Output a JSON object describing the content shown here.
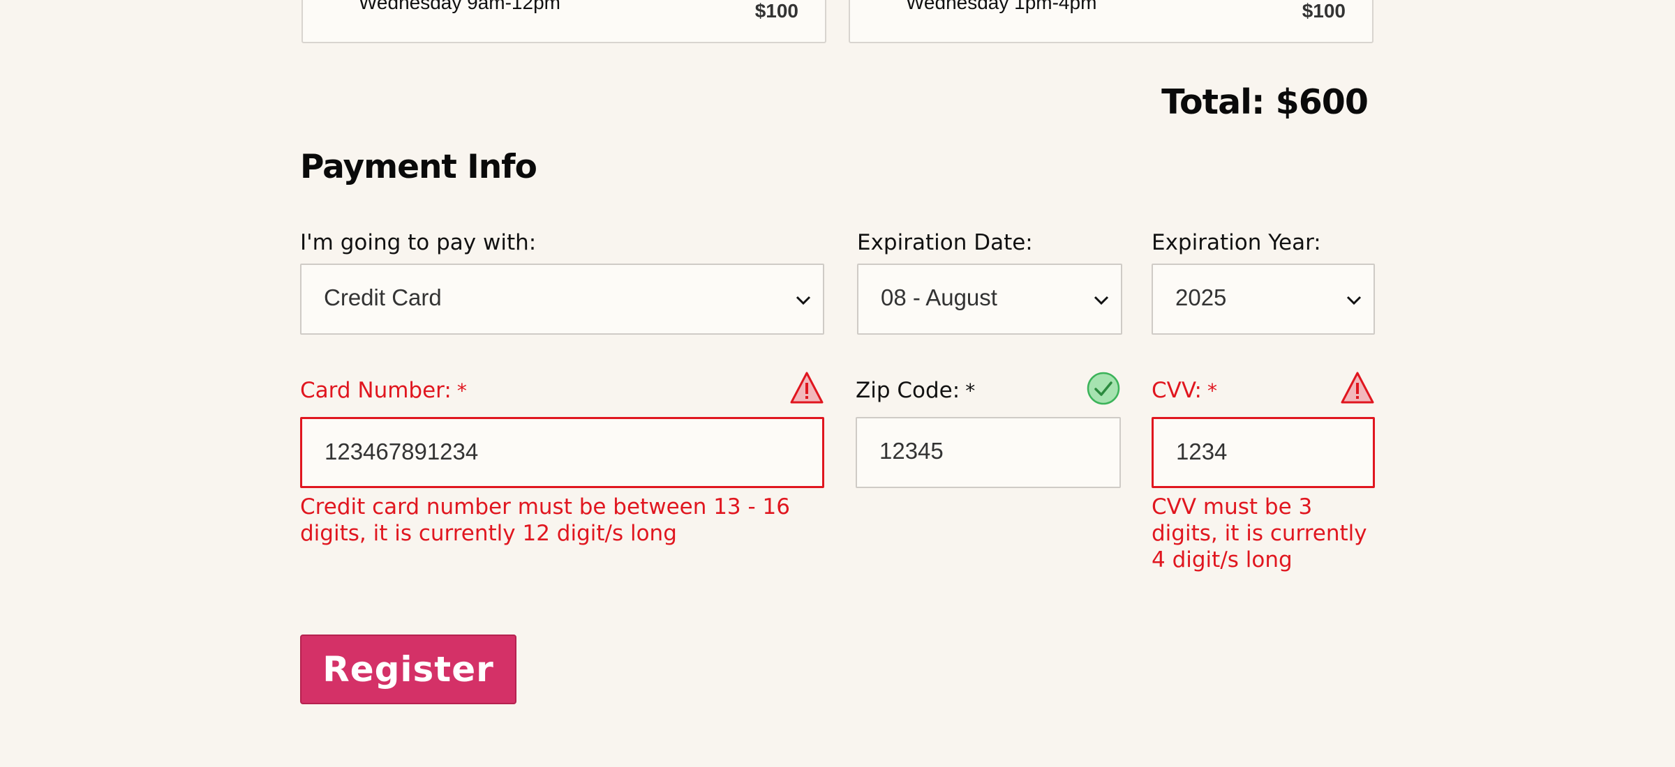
{
  "workshops": [
    {
      "time": "Wednesday 9am-12pm",
      "price": "$100"
    },
    {
      "time": "Wednesday 1pm-4pm",
      "price": "$100"
    }
  ],
  "total": "Total: $600",
  "payment": {
    "title": "Payment Info",
    "method": {
      "label": "I'm going to pay with:",
      "value": "Credit Card"
    },
    "exp_date": {
      "label": "Expiration Date:",
      "value": "08 - August"
    },
    "exp_year": {
      "label": "Expiration Year:",
      "value": "2025"
    },
    "card_number": {
      "label": "Card Number:",
      "required": "*",
      "value": "123467891234",
      "error": "Credit card number must be between 13 - 16 digits, it is currently 12 digit/s long"
    },
    "zip": {
      "label": "Zip Code:",
      "required": "*",
      "value": "12345"
    },
    "cvv": {
      "label": "CVV:",
      "required": "*",
      "value": "1234",
      "error": "CVV must be 3 digits, it is currently 4 digit/s long"
    }
  },
  "register_label": "Register",
  "colors": {
    "background": "#f9f5ef",
    "error": "#e0161f",
    "success": "#3cb35a",
    "button": "#d43167"
  },
  "icons": {
    "select": "chevron-down-icon",
    "error": "warning-triangle-icon",
    "valid": "checkmark-circle-icon"
  }
}
